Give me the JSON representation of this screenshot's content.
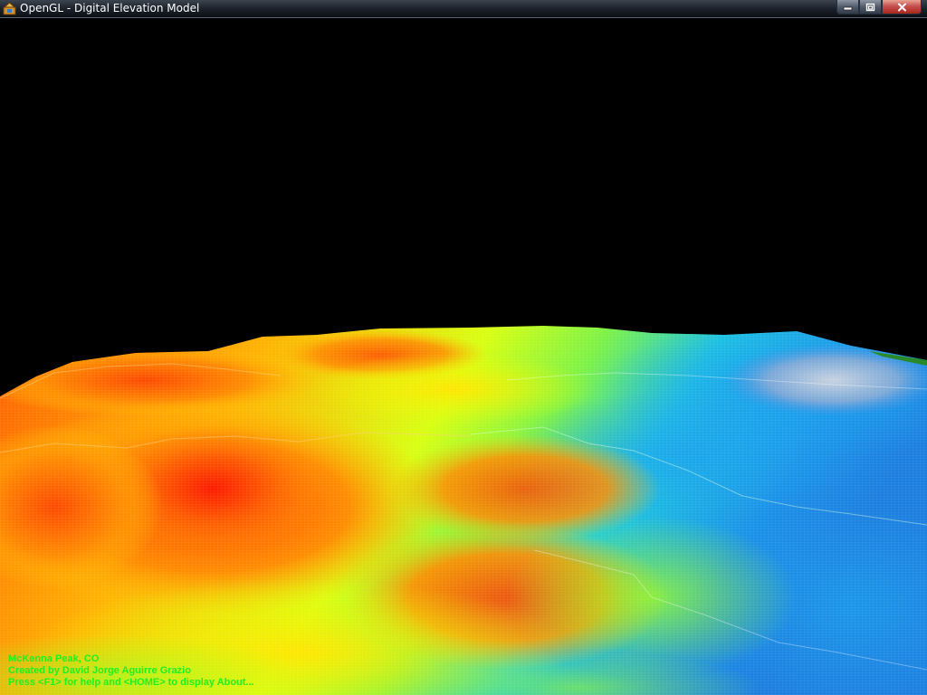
{
  "window": {
    "title": "OpenGL - Digital Elevation Model",
    "app_icon": "opengl-app-icon",
    "buttons": [
      {
        "name": "minimize-button",
        "icon": "minimize-icon"
      },
      {
        "name": "maximize-button",
        "icon": "restore-icon"
      },
      {
        "name": "close-button",
        "icon": "close-icon"
      }
    ]
  },
  "viewport": {
    "background": "#000000",
    "render": "3D wireframe terrain with elevation color ramp",
    "color_ramp": [
      "#ff0000",
      "#ff7a00",
      "#ffd400",
      "#c8ff00",
      "#3cf06e",
      "#18b4e8",
      "#1888e8",
      "#b8c8dc"
    ]
  },
  "overlay": {
    "color": "#22ee22",
    "lines": [
      "McKenna Peak, CO",
      "Created by David Jorge Aguirre Grazio",
      "Press <F1> for help and <HOME> to display About..."
    ]
  }
}
